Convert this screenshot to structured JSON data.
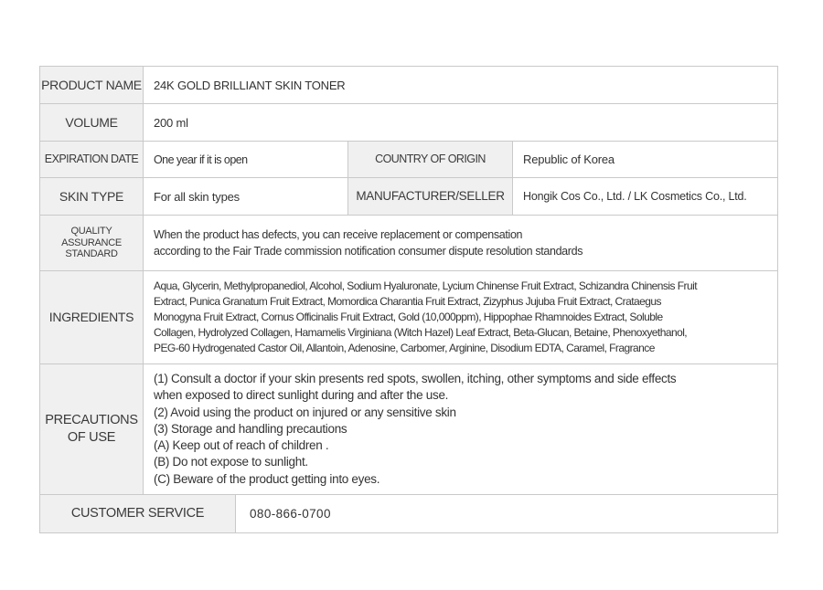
{
  "product_name": {
    "label": "PRODUCT NAME",
    "value": "24K GOLD BRILLIANT SKIN TONER"
  },
  "volume": {
    "label": "VOLUME",
    "value": "200 ml"
  },
  "expiration_date": {
    "label": "EXPIRATION DATE",
    "value": "One year if it is open"
  },
  "country_of_origin": {
    "label": "COUNTRY OF ORIGIN",
    "value": "Republic of Korea"
  },
  "skin_type": {
    "label": "SKIN TYPE",
    "value": "For all skin types"
  },
  "manufacturer": {
    "label": "MANUFACTURER/SELLER",
    "value": "Hongik Cos Co., Ltd. / LK Cosmetics Co., Ltd."
  },
  "quality_assurance": {
    "label_lines": [
      "QUALITY",
      "ASSURANCE",
      "STANDARD"
    ],
    "lines": [
      "When the product has defects, you can receive replacement or compensation",
      "according to the Fair Trade commission notification consumer dispute resolution standards"
    ]
  },
  "ingredients": {
    "label": "INGREDIENTS",
    "lines": [
      "Aqua, Glycerin, Methylpropanediol, Alcohol, Sodium Hyaluronate, Lycium Chinense Fruit Extract, Schizandra Chinensis Fruit",
      "Extract, Punica Granatum Fruit Extract, Momordica Charantia Fruit Extract, Zizyphus Jujuba Fruit Extract, Crataegus",
      "Monogyna Fruit Extract, Cornus Officinalis Fruit Extract, Gold (10,000ppm), Hippophae Rhamnoides Extract, Soluble",
      "Collagen, Hydrolyzed Collagen, Hamamelis Virginiana (Witch Hazel) Leaf Extract, Beta-Glucan, Betaine, Phenoxyethanol,",
      "PEG-60 Hydrogenated Castor Oil, Allantoin, Adenosine, Carbomer, Arginine, Disodium EDTA,  Caramel, Fragrance"
    ]
  },
  "precautions": {
    "label_lines": [
      "PRECAUTIONS",
      "OF USE"
    ],
    "lines": [
      "(1) Consult a doctor if your skin presents red spots, swollen, itching, other symptoms and side effects",
      "when exposed to direct sunlight during and after the use.",
      "(2) Avoid using the product on injured or any sensitive skin",
      "(3) Storage and handling precautions",
      "(A) Keep out of reach of children .",
      "(B) Do not expose to sunlight.",
      "(C) Beware of the product getting into eyes."
    ]
  },
  "customer_service": {
    "label": "CUSTOMER SERVICE",
    "value": "080-866-0700"
  }
}
